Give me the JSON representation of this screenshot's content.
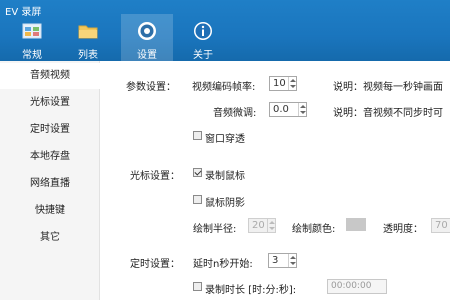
{
  "app": {
    "title": "EV 录屏"
  },
  "toolbar": {
    "items": [
      {
        "label": "常规",
        "icon": "grid-icon"
      },
      {
        "label": "列表",
        "icon": "folder-icon"
      },
      {
        "label": "设置",
        "icon": "gear-icon"
      },
      {
        "label": "关于",
        "icon": "info-icon"
      }
    ],
    "active": "设置",
    "bg_color": "#1a75bd"
  },
  "sidebar": {
    "items": [
      {
        "label": "音频视频"
      },
      {
        "label": "光标设置"
      },
      {
        "label": "定时设置"
      },
      {
        "label": "本地存盘"
      },
      {
        "label": "网络直播"
      },
      {
        "label": "快捷键"
      },
      {
        "label": "其它"
      }
    ],
    "active": "音频视频"
  },
  "params": {
    "section": "参数设置：",
    "framerate_label": "视频编码帧率:",
    "framerate_value": "10",
    "framerate_note": "说明：视频每一秒钟画面",
    "audio_adjust_label": "音频微调:",
    "audio_adjust_value": "0.0",
    "audio_adjust_note": "说明：音视频不同步时可",
    "window_through_label": "窗口穿透",
    "window_through_checked": false
  },
  "cursor": {
    "section": "光标设置：",
    "record_cursor_label": "录制鼠标",
    "record_cursor_checked": true,
    "cursor_shadow_label": "鼠标阴影",
    "cursor_shadow_checked": false,
    "radius_label": "绘制半径:",
    "radius_value": "20",
    "color_label": "绘制颜色:",
    "color_value": "#c8c8c8",
    "opacity_label": "透明度：",
    "opacity_value": "70"
  },
  "timer": {
    "section": "定时设置：",
    "delay_label": "延时n秒开始:",
    "delay_value": "3",
    "duration_label": "录制时长 [时:分:秒]:",
    "duration_checked": false,
    "duration_value": "00:00:00"
  }
}
